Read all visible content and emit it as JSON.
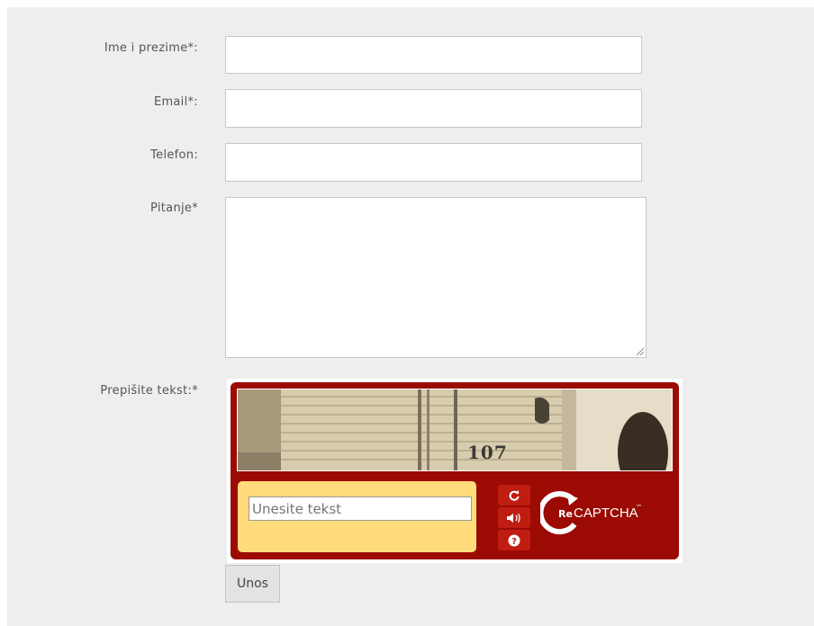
{
  "form": {
    "name_label": "Ime i prezime*:",
    "email_label": "Email*:",
    "phone_label": "Telefon:",
    "question_label": "Pitanje*",
    "captcha_label": "Prepišite tekst:*",
    "name_value": "",
    "email_value": "",
    "phone_value": "",
    "question_value": "",
    "submit_label": "Unos"
  },
  "captcha": {
    "image_text": "107",
    "input_placeholder": "Unesite tekst",
    "input_value": "",
    "reload_icon": "refresh-icon",
    "audio_icon": "speaker-icon",
    "help_icon": "question-icon",
    "logo_prefix": "Re",
    "logo_text": "CAPTCHA",
    "logo_tm": "™",
    "colors": {
      "frame": "#9b0b03",
      "answer_box": "#ffdb7c",
      "buttons": "#c01d12"
    }
  }
}
